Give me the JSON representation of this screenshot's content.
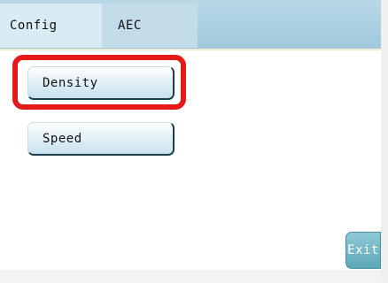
{
  "tabs": [
    {
      "label": "Config",
      "selected": true
    },
    {
      "label": "AEC",
      "selected": false
    }
  ],
  "menu": {
    "density_label": "Density",
    "speed_label": "Speed"
  },
  "exit_label": "Exit",
  "colors": {
    "highlight": "#e41a1a",
    "top_bar": "#9fc9dc",
    "exit_button": "#5ea8b8"
  }
}
